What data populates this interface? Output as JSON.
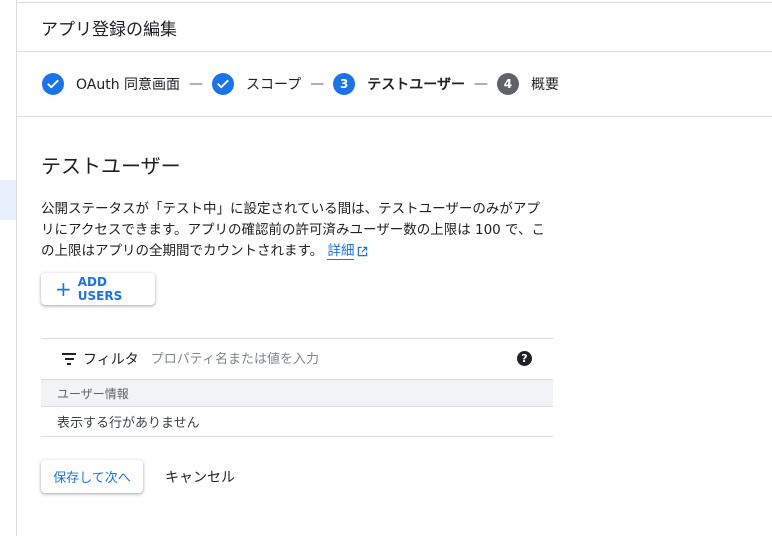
{
  "page": {
    "title": "アプリ登録の編集"
  },
  "stepper": {
    "steps": [
      {
        "label": "OAuth 同意画面",
        "status": "done"
      },
      {
        "label": "スコープ",
        "status": "done"
      },
      {
        "number": "3",
        "label": "テストユーザー",
        "status": "active"
      },
      {
        "number": "4",
        "label": "概要",
        "status": "todo"
      }
    ],
    "separator": "—"
  },
  "section": {
    "title": "テストユーザー",
    "description": "公開ステータスが「テスト中」に設定されている間は、テストユーザーのみがアプリにアクセスできます。アプリの確認前の許可済みユーザー数の上限は 100 で、この上限はアプリの全期間でカウントされます。",
    "learn_more": "詳細",
    "add_users_label": "ADD USERS"
  },
  "filter": {
    "label": "フィルタ",
    "placeholder": "プロパティ名または値を入力",
    "help_glyph": "?"
  },
  "table": {
    "columns": [
      "ユーザー情報"
    ],
    "empty_message": "表示する行がありません"
  },
  "actions": {
    "save_label": "保存して次へ",
    "cancel_label": "キャンセル"
  },
  "colors": {
    "accent": "#1a73e8",
    "border": "#dadce0",
    "text": "#202124",
    "muted": "#5f6368",
    "table_header_bg": "#f1f3f4"
  }
}
